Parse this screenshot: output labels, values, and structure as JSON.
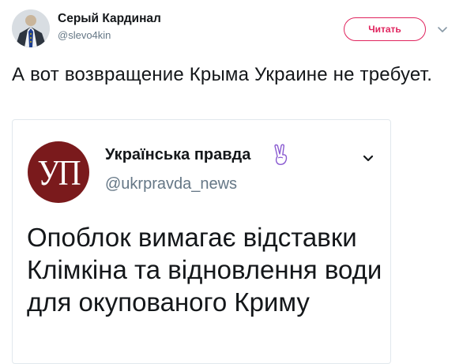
{
  "author": {
    "display_name": "Серый Кардинал",
    "handle": "@slevo4kin",
    "avatar_icon": "avatar-eu-flag-suit"
  },
  "follow_button": {
    "label": "Читать"
  },
  "caret_icon": "chevron-down-icon",
  "tweet": {
    "text": "А вот возвращение Крыма Украине не требует."
  },
  "quoted": {
    "logo_text": "УП",
    "display_name": "Українська правда",
    "name_emoji": "victory-hand-icon",
    "handle": "@ukrpravda_news",
    "text": "Опоблок вимагає відставки Клімкіна та відновлення води для окупованого Криму"
  },
  "colors": {
    "follow_accent": "#e0245e",
    "secondary_text": "#657786",
    "logo_bg": "#7a1a1c",
    "card_border": "#e1e8ed"
  }
}
